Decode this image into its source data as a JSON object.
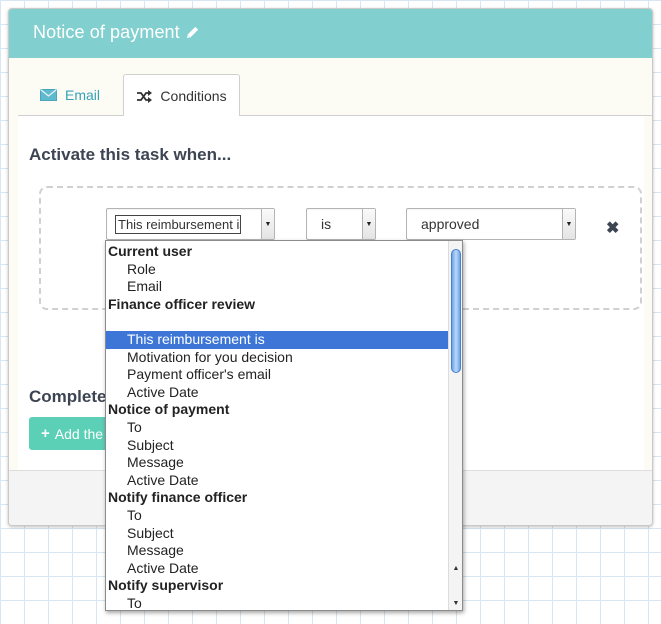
{
  "panel": {
    "title": "Notice of payment",
    "title_icon": "pencil-icon"
  },
  "tabs": [
    {
      "label": "Email",
      "icon": "envelope-icon",
      "active": false
    },
    {
      "label": "Conditions",
      "icon": "shuffle-icon",
      "active": true
    }
  ],
  "conditions": {
    "heading": "Activate this task when...",
    "field_select": "This reimbursement is",
    "operator_select": "is",
    "value_select": "approved",
    "remove_icon": "close-icon"
  },
  "complete": {
    "heading": "Complete",
    "add_button_label": "Add the"
  },
  "dropdown": {
    "selected": "This reimbursement is",
    "rows": [
      {
        "type": "group",
        "label": "Current user"
      },
      {
        "type": "option",
        "label": "Role"
      },
      {
        "type": "option",
        "label": "Email"
      },
      {
        "type": "group",
        "label": "Finance officer review"
      },
      {
        "type": "option",
        "label": ""
      },
      {
        "type": "option",
        "label": "This reimbursement is",
        "selected": true
      },
      {
        "type": "option",
        "label": "Motivation for you decision"
      },
      {
        "type": "option",
        "label": "Payment officer's email"
      },
      {
        "type": "option",
        "label": "Active Date"
      },
      {
        "type": "group",
        "label": "Notice of payment"
      },
      {
        "type": "option",
        "label": "To"
      },
      {
        "type": "option",
        "label": "Subject"
      },
      {
        "type": "option",
        "label": "Message"
      },
      {
        "type": "option",
        "label": "Active Date"
      },
      {
        "type": "group",
        "label": "Notify finance officer"
      },
      {
        "type": "option",
        "label": "To"
      },
      {
        "type": "option",
        "label": "Subject"
      },
      {
        "type": "option",
        "label": "Message"
      },
      {
        "type": "option",
        "label": "Active Date"
      },
      {
        "type": "group",
        "label": "Notify supervisor"
      },
      {
        "type": "option",
        "label": "To"
      }
    ]
  },
  "colors": {
    "header": "#82cfd0",
    "accent": "#35a2b8",
    "button": "#5ccfb7",
    "selection": "#3d76d6"
  }
}
